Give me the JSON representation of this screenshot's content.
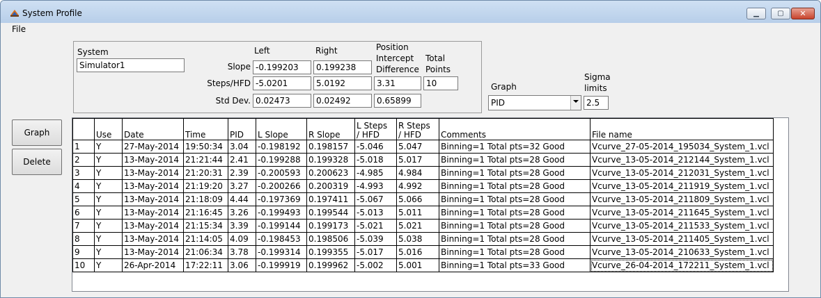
{
  "window": {
    "title": "System Profile"
  },
  "menu": {
    "file": "File"
  },
  "system": {
    "label": "System",
    "value": "Simulator1"
  },
  "columns": {
    "left": "Left",
    "right": "Right",
    "position_line1": "Position",
    "position_line2": "Intercept",
    "position_line3": "Difference",
    "total_line1": "Total",
    "total_line2": "Points"
  },
  "rows": {
    "slope_label": "Slope",
    "slope_left": "-0.199203",
    "slope_right": "0.199238",
    "steps_label": "Steps/HFD",
    "steps_left": "-5.0201",
    "steps_right": "5.0192",
    "steps_position": "3.31",
    "total_points": "10",
    "std_label": "Std Dev.",
    "std_left": "0.02473",
    "std_right": "0.02492",
    "std_position": "0.65899"
  },
  "graph_select": {
    "label": "Graph",
    "value": "PID"
  },
  "sigma": {
    "label_line1": "Sigma",
    "label_line2": "limits",
    "value": "2.5"
  },
  "buttons": {
    "graph": "Graph",
    "delete": "Delete"
  },
  "table": {
    "headers": {
      "num": "",
      "use": "Use",
      "date": "Date",
      "time": "Time",
      "pid": "PID",
      "lslope": "L Slope",
      "rslope": "R Slope",
      "lsteps1": "L Steps",
      "lsteps2": "/ HFD",
      "rsteps1": "R Steps",
      "rsteps2": "/ HFD",
      "comments": "Comments",
      "filename": "File name"
    },
    "rows": [
      {
        "num": "1",
        "use": "Y",
        "date": "27-May-2014",
        "time": "19:50:34",
        "pid": "3.04",
        "lslope": "-0.198192",
        "rslope": "0.198157",
        "lsteps": "-5.046",
        "rsteps": "5.047",
        "comments": "Binning=1 Total pts=32 Good",
        "filename": "Vcurve_27-05-2014_195034_System_1.vcl"
      },
      {
        "num": "2",
        "use": "Y",
        "date": "13-May-2014",
        "time": "21:21:44",
        "pid": "2.41",
        "lslope": "-0.199288",
        "rslope": "0.199328",
        "lsteps": "-5.018",
        "rsteps": "5.017",
        "comments": "Binning=1 Total pts=28 Good",
        "filename": "Vcurve_13-05-2014_212144_System_1.vcl"
      },
      {
        "num": "3",
        "use": "Y",
        "date": "13-May-2014",
        "time": "21:20:31",
        "pid": "2.39",
        "lslope": "-0.200593",
        "rslope": "0.200623",
        "lsteps": "-4.985",
        "rsteps": "4.984",
        "comments": "Binning=1 Total pts=28 Good",
        "filename": "Vcurve_13-05-2014_212031_System_1.vcl"
      },
      {
        "num": "4",
        "use": "Y",
        "date": "13-May-2014",
        "time": "21:19:20",
        "pid": "3.27",
        "lslope": "-0.200266",
        "rslope": "0.200319",
        "lsteps": "-4.993",
        "rsteps": "4.992",
        "comments": "Binning=1 Total pts=28 Good",
        "filename": "Vcurve_13-05-2014_211919_System_1.vcl"
      },
      {
        "num": "5",
        "use": "Y",
        "date": "13-May-2014",
        "time": "21:18:09",
        "pid": "4.44",
        "lslope": "-0.197369",
        "rslope": "0.197411",
        "lsteps": "-5.067",
        "rsteps": "5.066",
        "comments": "Binning=1 Total pts=28 Good",
        "filename": "Vcurve_13-05-2014_211809_System_1.vcl"
      },
      {
        "num": "6",
        "use": "Y",
        "date": "13-May-2014",
        "time": "21:16:45",
        "pid": "3.26",
        "lslope": "-0.199493",
        "rslope": "0.199544",
        "lsteps": "-5.013",
        "rsteps": "5.011",
        "comments": "Binning=1 Total pts=28 Good",
        "filename": "Vcurve_13-05-2014_211645_System_1.vcl"
      },
      {
        "num": "7",
        "use": "Y",
        "date": "13-May-2014",
        "time": "21:15:34",
        "pid": "3.39",
        "lslope": "-0.199144",
        "rslope": "0.199173",
        "lsteps": "-5.021",
        "rsteps": "5.021",
        "comments": "Binning=1 Total pts=28 Good",
        "filename": "Vcurve_13-05-2014_211533_System_1.vcl"
      },
      {
        "num": "8",
        "use": "Y",
        "date": "13-May-2014",
        "time": "21:14:05",
        "pid": "4.09",
        "lslope": "-0.198453",
        "rslope": "0.198506",
        "lsteps": "-5.039",
        "rsteps": "5.038",
        "comments": "Binning=1 Total pts=28 Good",
        "filename": "Vcurve_13-05-2014_211405_System_1.vcl"
      },
      {
        "num": "9",
        "use": "Y",
        "date": "13-May-2014",
        "time": "21:06:34",
        "pid": "3.78",
        "lslope": "-0.199314",
        "rslope": "0.199355",
        "lsteps": "-5.017",
        "rsteps": "5.016",
        "comments": "Binning=1 Total pts=28 Good",
        "filename": "Vcurve_13-05-2014_210633_System_1.vcl"
      },
      {
        "num": "10",
        "use": "Y",
        "date": "26-Apr-2014",
        "time": "17:22:11",
        "pid": "3.06",
        "lslope": "-0.199919",
        "rslope": "0.199962",
        "lsteps": "-5.002",
        "rsteps": "5.001",
        "comments": "Binning=1 Total pts=33 Good",
        "filename": "Vcurve_26-04-2014_172211_System_1.vcl"
      }
    ]
  }
}
